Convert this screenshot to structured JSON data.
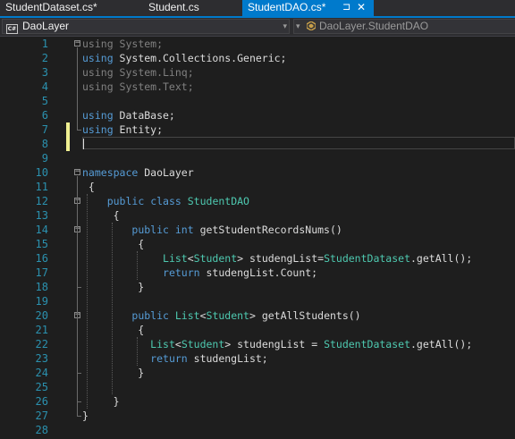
{
  "tabs": [
    {
      "label": "StudentDataset.cs*",
      "active": false
    },
    {
      "label": "Student.cs",
      "active": false
    },
    {
      "label": "StudentDAO.cs*",
      "active": true,
      "pin_glyph": "⊐",
      "close_glyph": "✕"
    }
  ],
  "navbar": {
    "project_icon_text": "C#",
    "project": "DaoLayer",
    "dropdown_glyph": "▾",
    "member": "DaoLayer.StudentDAO"
  },
  "editor": {
    "lines": [
      {
        "n": "1",
        "tokens": [
          {
            "t": "using",
            "c": "gr"
          },
          {
            "t": " System;",
            "c": "gr"
          }
        ]
      },
      {
        "n": "2",
        "tokens": [
          {
            "t": "using",
            "c": "kw"
          },
          {
            "t": " System.Collections.Generic;",
            "c": "pl"
          }
        ]
      },
      {
        "n": "3",
        "tokens": [
          {
            "t": "using",
            "c": "gr"
          },
          {
            "t": " System.Linq;",
            "c": "gr"
          }
        ]
      },
      {
        "n": "4",
        "tokens": [
          {
            "t": "using",
            "c": "gr"
          },
          {
            "t": " System.Text;",
            "c": "gr"
          }
        ]
      },
      {
        "n": "5",
        "tokens": []
      },
      {
        "n": "6",
        "tokens": [
          {
            "t": "using",
            "c": "kw"
          },
          {
            "t": " DataBase;",
            "c": "pl"
          }
        ]
      },
      {
        "n": "7",
        "tokens": [
          {
            "t": "using",
            "c": "kw"
          },
          {
            "t": " Entity;",
            "c": "pl"
          }
        ]
      },
      {
        "n": "8",
        "tokens": []
      },
      {
        "n": "9",
        "tokens": []
      },
      {
        "n": "10",
        "tokens": [
          {
            "t": "namespace",
            "c": "kw"
          },
          {
            "t": " DaoLayer",
            "c": "pl"
          }
        ]
      },
      {
        "n": "11",
        "tokens": [
          {
            "t": " {",
            "c": "pl"
          }
        ]
      },
      {
        "n": "12",
        "tokens": [
          {
            "t": "    ",
            "c": "pl"
          },
          {
            "t": "public",
            "c": "kw"
          },
          {
            "t": " ",
            "c": "pl"
          },
          {
            "t": "class",
            "c": "kw"
          },
          {
            "t": " ",
            "c": "pl"
          },
          {
            "t": "StudentDAO",
            "c": "ty"
          }
        ]
      },
      {
        "n": "13",
        "tokens": [
          {
            "t": "     {",
            "c": "pl"
          }
        ]
      },
      {
        "n": "14",
        "tokens": [
          {
            "t": "        ",
            "c": "pl"
          },
          {
            "t": "public",
            "c": "kw"
          },
          {
            "t": " ",
            "c": "pl"
          },
          {
            "t": "int",
            "c": "kw"
          },
          {
            "t": " getStudentRecordsNums()",
            "c": "pl"
          }
        ]
      },
      {
        "n": "15",
        "tokens": [
          {
            "t": "         {",
            "c": "pl"
          }
        ]
      },
      {
        "n": "16",
        "tokens": [
          {
            "t": "             ",
            "c": "pl"
          },
          {
            "t": "List",
            "c": "ty"
          },
          {
            "t": "<",
            "c": "pl"
          },
          {
            "t": "Student",
            "c": "ty"
          },
          {
            "t": "> studengList=",
            "c": "pl"
          },
          {
            "t": "StudentDataset",
            "c": "ty"
          },
          {
            "t": ".getAll();",
            "c": "pl"
          }
        ]
      },
      {
        "n": "17",
        "tokens": [
          {
            "t": "             ",
            "c": "pl"
          },
          {
            "t": "return",
            "c": "kw"
          },
          {
            "t": " studengList.Count;",
            "c": "pl"
          }
        ]
      },
      {
        "n": "18",
        "tokens": [
          {
            "t": "         }",
            "c": "pl"
          }
        ]
      },
      {
        "n": "19",
        "tokens": []
      },
      {
        "n": "20",
        "tokens": [
          {
            "t": "        ",
            "c": "pl"
          },
          {
            "t": "public",
            "c": "kw"
          },
          {
            "t": " ",
            "c": "pl"
          },
          {
            "t": "List",
            "c": "ty"
          },
          {
            "t": "<",
            "c": "pl"
          },
          {
            "t": "Student",
            "c": "ty"
          },
          {
            "t": "> getAllStudents()",
            "c": "pl"
          }
        ]
      },
      {
        "n": "21",
        "tokens": [
          {
            "t": "         {",
            "c": "pl"
          }
        ]
      },
      {
        "n": "22",
        "tokens": [
          {
            "t": "           ",
            "c": "pl"
          },
          {
            "t": "List",
            "c": "ty"
          },
          {
            "t": "<",
            "c": "pl"
          },
          {
            "t": "Student",
            "c": "ty"
          },
          {
            "t": "> studengList = ",
            "c": "pl"
          },
          {
            "t": "StudentDataset",
            "c": "ty"
          },
          {
            "t": ".getAll();",
            "c": "pl"
          }
        ]
      },
      {
        "n": "23",
        "tokens": [
          {
            "t": "           ",
            "c": "pl"
          },
          {
            "t": "return",
            "c": "kw"
          },
          {
            "t": " studengList;",
            "c": "pl"
          }
        ]
      },
      {
        "n": "24",
        "tokens": [
          {
            "t": "         }",
            "c": "pl"
          }
        ]
      },
      {
        "n": "25",
        "tokens": []
      },
      {
        "n": "26",
        "tokens": [
          {
            "t": "     }",
            "c": "pl"
          }
        ]
      },
      {
        "n": "27",
        "tokens": [
          {
            "t": "}",
            "c": "pl"
          }
        ]
      },
      {
        "n": "28",
        "tokens": []
      }
    ]
  },
  "colors": {
    "keyword": "#569cd6",
    "type": "#4ec9b0",
    "unused_using": "#808080",
    "text": "#dcdcdc",
    "line_number": "#2b91af",
    "accent": "#007acc",
    "change_marker": "#efef91"
  }
}
